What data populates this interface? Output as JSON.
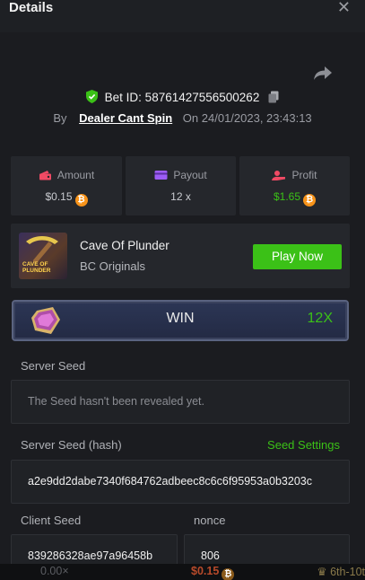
{
  "header": {
    "title": "Details",
    "close_icon": "close-icon"
  },
  "bet": {
    "id_text": "Bet ID: 58761427556500262",
    "by_label": "By",
    "user": "Dealer Cant Spin",
    "on_label": "On",
    "datetime": "24/01/2023, 23:43:13"
  },
  "stats": {
    "amount": {
      "label": "Amount",
      "value": "$0.15",
      "icon": "wallet-icon"
    },
    "payout": {
      "label": "Payout",
      "value": "12 x",
      "icon": "card-icon"
    },
    "profit": {
      "label": "Profit",
      "value": "$1.65",
      "icon": "profit-icon"
    }
  },
  "game": {
    "name": "Cave Of Plunder",
    "provider": "BC Originals",
    "thumb_text": "CAVE OF PLUNDER",
    "play_label": "Play Now"
  },
  "result": {
    "text": "WIN",
    "multiplier": "12X"
  },
  "server_seed": {
    "label": "Server Seed",
    "value": "The Seed hasn't been revealed yet."
  },
  "server_seed_hash": {
    "label": "Server Seed (hash)",
    "settings_label": "Seed Settings",
    "value": "a2e9dd2dabe7340f684762adbeec8c6c6f95953a0b3203c"
  },
  "client_seed": {
    "label": "Client Seed",
    "value": "839286328ae97a96458b"
  },
  "nonce": {
    "label": "nonce",
    "value": "806"
  },
  "footer": {
    "left": "0.00×",
    "middle": "$0.15",
    "right": "6th-10t"
  },
  "colors": {
    "accent_green": "#3bc117",
    "bitcoin": "#f7931a",
    "background": "#1b1c20"
  }
}
